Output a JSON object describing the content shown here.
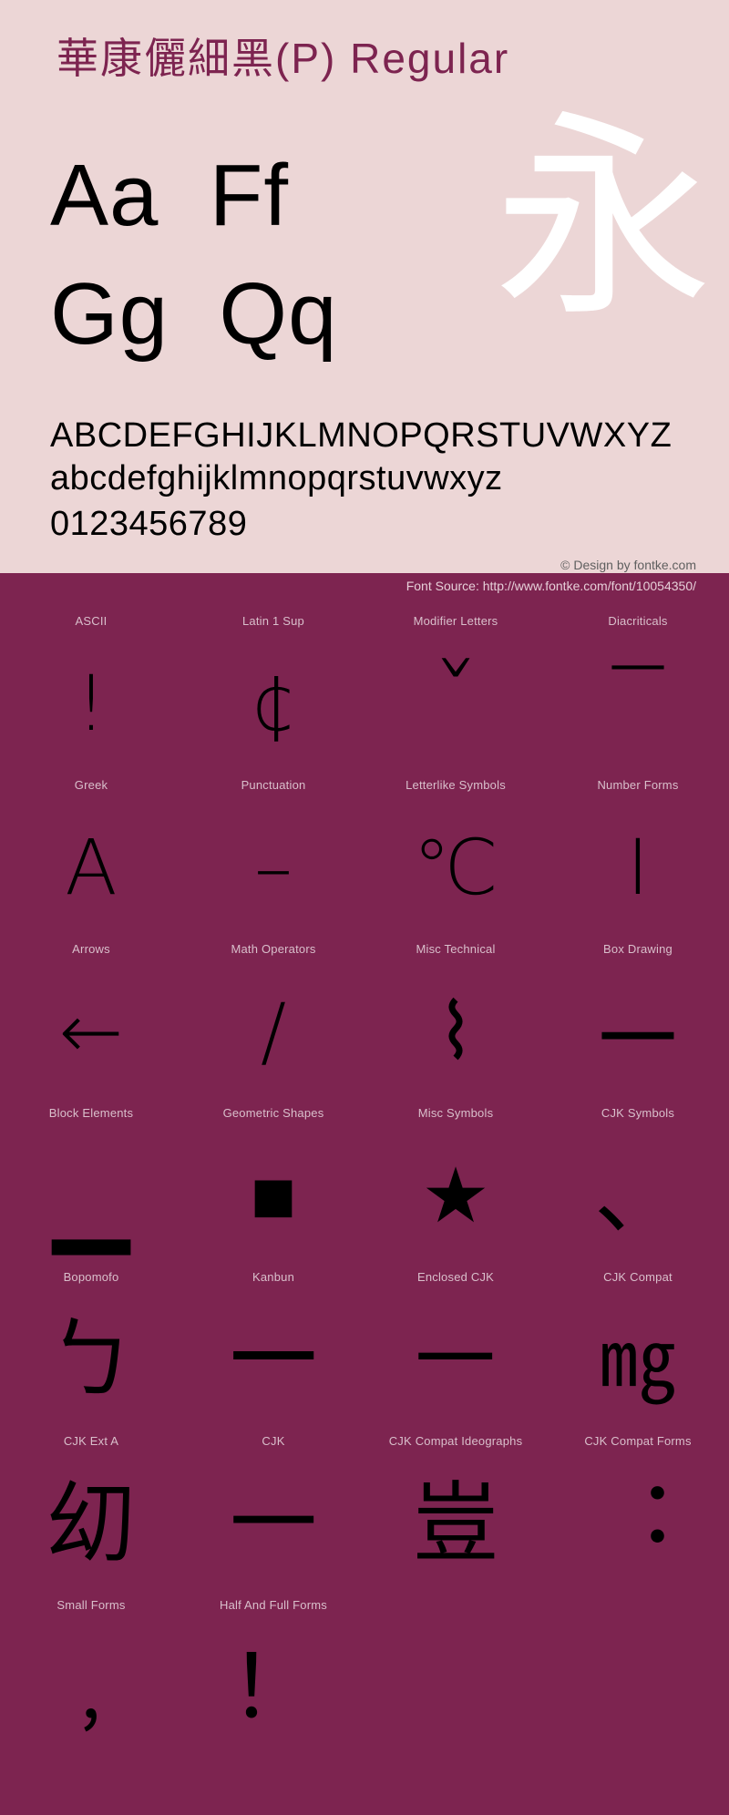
{
  "header": {
    "title": "華康儷細黑(P) Regular",
    "hero_glyph": "永",
    "sample_pairs": [
      "Aa  Ff",
      "Gg  Qq"
    ],
    "uppercase": "ABCDEFGHIJKLMNOPQRSTUVWXYZ",
    "lowercase": "abcdefghijklmnopqrstuvwxyz",
    "digits": "0123456789",
    "credit": "© Design by fontke.com"
  },
  "source_bar": {
    "text": "Font Source: http://www.fontke.com/font/10054350/"
  },
  "colors": {
    "header_bg": "#ecd6d6",
    "accent": "#7d2450",
    "title": "#7d2450",
    "glyph": "#000000",
    "label": "#d9bfcb",
    "hero": "#ffffff"
  },
  "grid": {
    "rows": [
      [
        {
          "label": "ASCII",
          "glyph": "!",
          "size": "normal"
        },
        {
          "label": "Latin 1 Sup",
          "glyph": "¢",
          "size": "normal"
        },
        {
          "label": "Modifier Letters",
          "glyph": "ˇ",
          "size": "wide"
        },
        {
          "label": "Diacriticals",
          "glyph": "‾",
          "size": "wide"
        }
      ],
      [
        {
          "label": "Greek",
          "glyph": "Α",
          "size": "normal"
        },
        {
          "label": "Punctuation",
          "glyph": "–",
          "size": "normal"
        },
        {
          "label": "Letterlike Symbols",
          "glyph": "℃",
          "size": "normal"
        },
        {
          "label": "Number Forms",
          "glyph": "Ⅰ",
          "size": "normal"
        }
      ],
      [
        {
          "label": "Arrows",
          "glyph": "←",
          "size": "normal"
        },
        {
          "label": "Math Operators",
          "glyph": "∕",
          "size": "normal"
        },
        {
          "label": "Misc Technical",
          "glyph": "⌇",
          "size": "normal"
        },
        {
          "label": "Box Drawing",
          "glyph": "─",
          "size": "wide"
        }
      ],
      [
        {
          "label": "Block Elements",
          "glyph": "▁",
          "size": "wide"
        },
        {
          "label": "Geometric Shapes",
          "glyph": "■",
          "size": "normal"
        },
        {
          "label": "Misc Symbols",
          "glyph": "★",
          "size": "normal"
        },
        {
          "label": "CJK Symbols",
          "glyph": "、",
          "size": "cjk"
        }
      ],
      [
        {
          "label": "Bopomofo",
          "glyph": "ㄅ",
          "size": "cjk"
        },
        {
          "label": "Kanbun",
          "glyph": "㆒",
          "size": "cjk"
        },
        {
          "label": "Enclosed CJK",
          "glyph": "㇐",
          "size": "cjk"
        },
        {
          "label": "CJK Compat",
          "glyph": "㎎",
          "size": "normal"
        }
      ],
      [
        {
          "label": "CJK Ext A",
          "glyph": "㓜",
          "size": "cjk"
        },
        {
          "label": "CJK",
          "glyph": "一",
          "size": "cjk"
        },
        {
          "label": "CJK Compat Ideographs",
          "glyph": "豈",
          "size": "cjk"
        },
        {
          "label": "CJK Compat Forms",
          "glyph": "︓",
          "size": "cjk"
        }
      ],
      [
        {
          "label": "Small Forms",
          "glyph": "﹐",
          "size": "cjk"
        },
        {
          "label": "Half And Full Forms",
          "glyph": "！",
          "size": "cjk"
        },
        {
          "label": "",
          "glyph": "",
          "size": "normal"
        },
        {
          "label": "",
          "glyph": "",
          "size": "normal"
        }
      ]
    ]
  }
}
